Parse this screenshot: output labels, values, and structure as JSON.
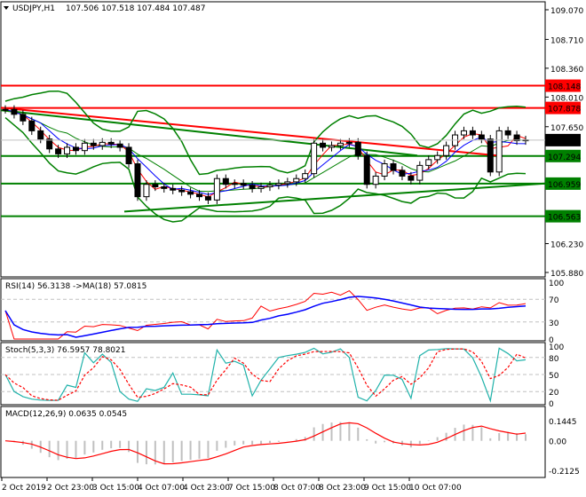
{
  "header": {
    "symbol": "USDJPY,H1",
    "ohlc": "107.506 107.518 107.484 107.487"
  },
  "price_axis": {
    "ticks": [
      "109.070",
      "108.710",
      "108.360",
      "108.010",
      "107.650",
      "106.230",
      "105.880"
    ],
    "tick_values": [
      109.07,
      108.71,
      108.36,
      108.01,
      107.65,
      106.23,
      105.88
    ],
    "min": 105.88,
    "max": 109.07
  },
  "levels": [
    {
      "value": 108.148,
      "label": "108.148",
      "color": "#ff0000"
    },
    {
      "value": 107.878,
      "label": "107.878",
      "color": "#ff0000"
    },
    {
      "value": 107.294,
      "label": "107.294",
      "color": "#008000"
    },
    {
      "value": 106.959,
      "label": "106.959",
      "color": "#008000"
    },
    {
      "value": 106.563,
      "label": "106.563",
      "color": "#008000"
    }
  ],
  "current_price": {
    "value": 107.487,
    "label": "107.487"
  },
  "rsi": {
    "label": "RSI(14) 56.3138  ->MA(18) 57.0815",
    "ticks": [
      "100",
      "70",
      "30",
      "0"
    ]
  },
  "stoch": {
    "label": "Stoch(5,3,3) 76.5957 78.8021",
    "ticks": [
      "100",
      "80",
      "50",
      "20",
      "0"
    ]
  },
  "macd": {
    "label": "MACD(12,26,9) 0.0635 0.0545",
    "ticks": [
      "0.1445",
      "0.00",
      "-0.2125"
    ]
  },
  "time_axis": [
    "2 Oct 2019",
    "2 Oct 23:00",
    "3 Oct 15:00",
    "4 Oct 07:00",
    "4 Oct 23:00",
    "7 Oct 15:00",
    "8 Oct 07:00",
    "8 Oct 23:00",
    "9 Oct 15:00",
    "10 Oct 07:00"
  ],
  "chart_data": {
    "type": "candlestick",
    "title": "USDJPY,H1",
    "closes": [
      107.86,
      107.8,
      107.72,
      107.6,
      107.5,
      107.38,
      107.32,
      107.4,
      107.36,
      107.45,
      107.42,
      107.46,
      107.44,
      107.4,
      107.2,
      106.8,
      106.95,
      106.92,
      106.9,
      106.88,
      106.86,
      106.83,
      106.8,
      106.76,
      107.02,
      106.95,
      106.96,
      106.94,
      106.9,
      106.92,
      106.94,
      106.96,
      106.98,
      107.02,
      107.08,
      107.45,
      107.4,
      107.42,
      107.45,
      107.46,
      107.3,
      106.95,
      107.05,
      107.2,
      107.12,
      107.05,
      107.0,
      107.18,
      107.25,
      107.3,
      107.42,
      107.55,
      107.6,
      107.55,
      107.5,
      107.1,
      107.6,
      107.55,
      107.48,
      107.49
    ],
    "ylim": [
      105.88,
      109.07
    ]
  }
}
